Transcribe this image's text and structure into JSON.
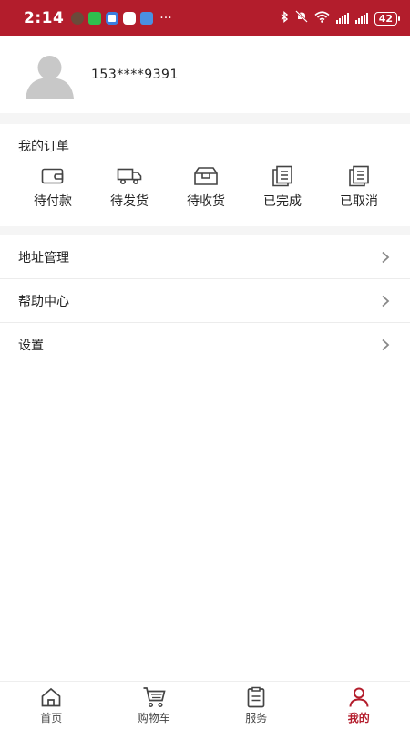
{
  "status_bar": {
    "time": "2:14",
    "more": "···",
    "battery": "42"
  },
  "profile": {
    "phone": "153****9391",
    "avatar_icon": "user-silhouette-icon"
  },
  "orders": {
    "title": "我的订单",
    "items": [
      {
        "label": "待付款",
        "icon": "wallet-icon"
      },
      {
        "label": "待发货",
        "icon": "truck-icon"
      },
      {
        "label": "待收货",
        "icon": "package-icon"
      },
      {
        "label": "已完成",
        "icon": "documents-icon"
      },
      {
        "label": "已取消",
        "icon": "documents-icon"
      }
    ]
  },
  "menu": {
    "items": [
      {
        "label": "地址管理"
      },
      {
        "label": "帮助中心"
      },
      {
        "label": "设置"
      }
    ]
  },
  "tabbar": {
    "items": [
      {
        "label": "首页",
        "icon": "home-icon"
      },
      {
        "label": "购物车",
        "icon": "cart-icon"
      },
      {
        "label": "服务",
        "icon": "clipboard-icon"
      },
      {
        "label": "我的",
        "icon": "user-icon",
        "active": true
      }
    ]
  },
  "colors": {
    "brand": "#b31d2c",
    "text": "#222222",
    "divider": "#f5f5f5"
  }
}
